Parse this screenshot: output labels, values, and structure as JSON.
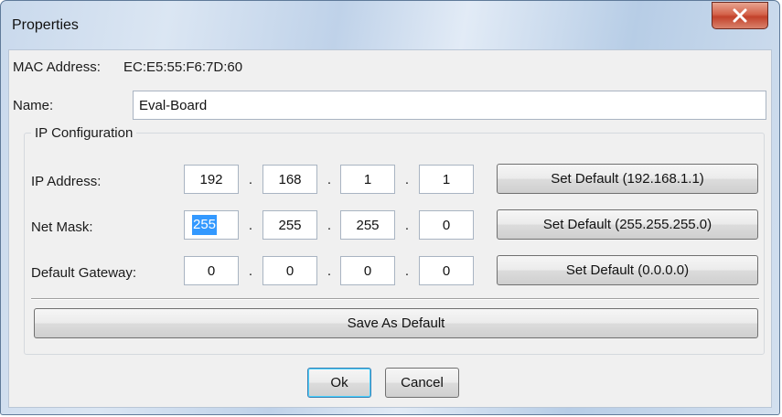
{
  "window": {
    "title": "Properties"
  },
  "mac": {
    "label": "MAC Address:",
    "value": "EC:E5:55:F6:7D:60"
  },
  "name": {
    "label": "Name:",
    "value": "Eval-Board"
  },
  "ip_config": {
    "title": "IP Configuration",
    "rows": [
      {
        "label": "IP Address:",
        "octets": [
          "192",
          "168",
          "1",
          "1"
        ],
        "default_button": "Set Default (192.168.1.1)"
      },
      {
        "label": "Net Mask:",
        "octets": [
          "255",
          "255",
          "255",
          "0"
        ],
        "default_button": "Set Default (255.255.255.0)"
      },
      {
        "label": "Default Gateway:",
        "octets": [
          "0",
          "0",
          "0",
          "0"
        ],
        "default_button": "Set Default (0.0.0.0)"
      }
    ],
    "separator": "."
  },
  "buttons": {
    "save_default": "Save As Default",
    "ok": "Ok",
    "cancel": "Cancel"
  }
}
